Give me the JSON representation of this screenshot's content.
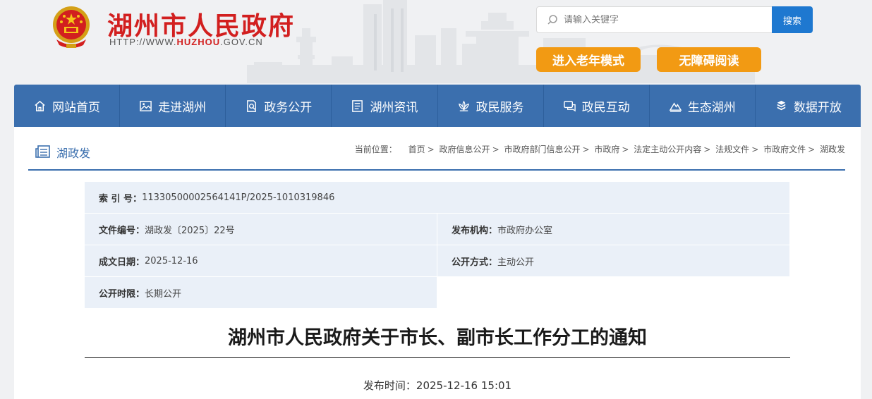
{
  "header": {
    "site_title": "湖州市人民政府",
    "url_prefix": "HTTP://WWW.",
    "url_brand": "HUZHOU",
    "url_suffix": ".GOV.CN",
    "search_placeholder": "请输入关键字",
    "search_button": "搜索",
    "elder_mode": "进入老年模式",
    "accessible_reading": "无障碍阅读"
  },
  "nav": {
    "items": [
      {
        "label": "网站首页",
        "icon": "home-icon"
      },
      {
        "label": "走进湖州",
        "icon": "picture-icon"
      },
      {
        "label": "政务公开",
        "icon": "document-search-icon"
      },
      {
        "label": "湖州资讯",
        "icon": "news-icon"
      },
      {
        "label": "政民服务",
        "icon": "lotus-icon"
      },
      {
        "label": "政民互动",
        "icon": "chat-icon"
      },
      {
        "label": "生态湖州",
        "icon": "mountain-icon"
      },
      {
        "label": "数据开放",
        "icon": "cubes-icon"
      }
    ]
  },
  "section": {
    "name": "湖政发",
    "breadcrumb_label": "当前位置：",
    "breadcrumb": [
      "首页",
      "政府信息公开",
      "市政府部门信息公开",
      "市政府",
      "法定主动公开内容",
      "法规文件",
      "市政府文件",
      "湖政发"
    ]
  },
  "meta": {
    "index_key": "索 引 号：",
    "index_value": "11330500002564141P/2025-1010319846",
    "doc_no_key": "文件编号：",
    "doc_no_value": "湖政发〔2025〕22号",
    "issuer_key": "发布机构：",
    "issuer_value": "市政府办公室",
    "date_key": "成文日期：",
    "date_value": "2025-12-16",
    "mode_key": "公开方式：",
    "mode_value": "主动公开",
    "term_key": "公开时限：",
    "term_value": "长期公开"
  },
  "document": {
    "title": "湖州市人民政府关于市长、副市长工作分工的通知",
    "publish_label": "发布时间：",
    "publish_time": "2025-12-16 15:01"
  },
  "colors": {
    "brand_red": "#d21f1f",
    "nav_blue": "#3b6fae",
    "search_blue": "#1e78d0",
    "orange": "#f29a13",
    "meta_tint": "#eaf0f8"
  }
}
